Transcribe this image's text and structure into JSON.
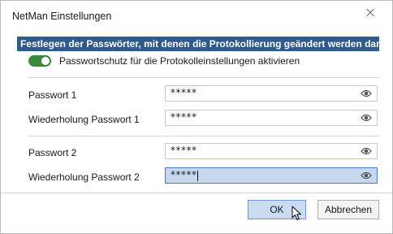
{
  "window": {
    "title": "NetMan Einstellungen",
    "close_glyph": "×"
  },
  "section": {
    "title": "Festlegen der Passwörter, mit denen die Protokollierung geändert werden darf"
  },
  "toggle": {
    "label": "Passwortschutz für die Protokolleinstellungen aktivieren",
    "on": true,
    "color": "#3b8a3b"
  },
  "fields": [
    {
      "label": "Passwort 1",
      "value": "*****",
      "icon": "eye-icon"
    },
    {
      "label": "Wiederholung Passwort 1",
      "value": "*****",
      "icon": "eye-icon"
    },
    {
      "label": "Passwort 2",
      "value": "*****",
      "icon": "eye-icon"
    },
    {
      "label": "Wiederholung Passwort 2",
      "value": "*****",
      "icon": "eye-icon",
      "focused": true
    }
  ],
  "buttons": {
    "ok": "OK",
    "cancel": "Abbrechen"
  },
  "colors": {
    "header_bg": "#2e5a8e",
    "active_field_bg": "#c7d7ee",
    "ok_bg": "#c9dcf2"
  }
}
